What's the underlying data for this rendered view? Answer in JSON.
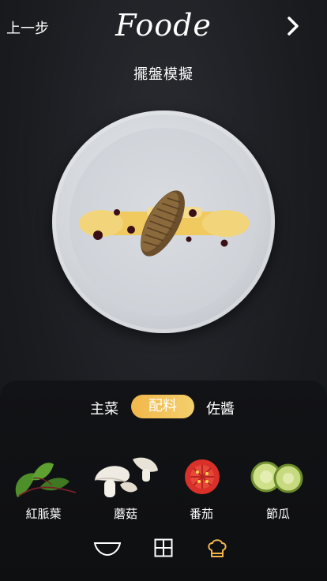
{
  "header": {
    "back_label": "上一步",
    "logo_text": "Foode",
    "next_icon": "chevron-right-icon"
  },
  "subtitle": "擺盤模擬",
  "tabs": [
    {
      "label": "主菜",
      "active": false
    },
    {
      "label": "配料",
      "active": true
    },
    {
      "label": "佐醬",
      "active": false
    }
  ],
  "ingredients": [
    {
      "label": "紅脈葉",
      "icon": "red-vein-sorrel-icon"
    },
    {
      "label": "蘑菇",
      "icon": "mushroom-icon"
    },
    {
      "label": "番茄",
      "icon": "tomato-icon"
    },
    {
      "label": "節瓜",
      "icon": "zucchini-icon"
    }
  ],
  "toolbar": [
    {
      "icon": "bowl-icon"
    },
    {
      "icon": "grid-icon"
    },
    {
      "icon": "chef-hat-icon",
      "active": true
    }
  ],
  "colors": {
    "accent": "#f2b84b",
    "sauce": "#f4c84e",
    "background": "#1b1c20"
  }
}
